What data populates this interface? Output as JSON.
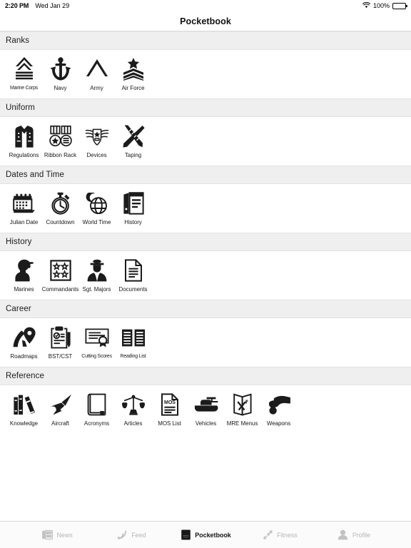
{
  "status_bar": {
    "time": "2:20 PM",
    "date": "Wed Jan 29",
    "battery_percent": "100%",
    "wifi_icon": "wifi-icon",
    "battery_icon": "battery-full-icon"
  },
  "nav": {
    "title": "Pocketbook"
  },
  "sections": [
    {
      "title": "Ranks",
      "items": [
        {
          "label": "Marine Corps",
          "icon": "chevron-rank-insignia-icon"
        },
        {
          "label": "Navy",
          "icon": "anchor-icon"
        },
        {
          "label": "Army",
          "icon": "chevron-stripe-icon"
        },
        {
          "label": "Air Force",
          "icon": "star-chevrons-icon"
        }
      ]
    },
    {
      "title": "Uniform",
      "items": [
        {
          "label": "Regulations",
          "icon": "uniform-jacket-icon"
        },
        {
          "label": "Ribbon Rack",
          "icon": "medals-icon"
        },
        {
          "label": "Devices",
          "icon": "winged-badge-icon"
        },
        {
          "label": "Taping",
          "icon": "ruler-pencil-cross-icon"
        }
      ]
    },
    {
      "title": "Dates and Time",
      "items": [
        {
          "label": "Julian Date",
          "icon": "calendar-icon"
        },
        {
          "label": "Countdown",
          "icon": "stopwatch-icon"
        },
        {
          "label": "World Time",
          "icon": "globe-moon-icon"
        },
        {
          "label": "History",
          "icon": "books-shelf-icon"
        }
      ]
    },
    {
      "title": "History",
      "items": [
        {
          "label": "Marines",
          "icon": "soldier-silhouette-icon"
        },
        {
          "label": "Commandants",
          "icon": "four-stars-icon"
        },
        {
          "label": "Sgt. Majors",
          "icon": "officer-portrait-icon"
        },
        {
          "label": "Documents",
          "icon": "document-icon"
        }
      ]
    },
    {
      "title": "Career",
      "items": [
        {
          "label": "Roadmaps",
          "icon": "road-pin-icon"
        },
        {
          "label": "BST/CST",
          "icon": "clipboard-pencil-icon"
        },
        {
          "label": "Cutting Scores",
          "icon": "certificate-icon"
        },
        {
          "label": "Reading List",
          "icon": "open-book-icon"
        }
      ]
    },
    {
      "title": "Reference",
      "items": [
        {
          "label": "Knowledge",
          "icon": "books-stack-icon"
        },
        {
          "label": "Aircraft",
          "icon": "jet-icon"
        },
        {
          "label": "Acronyms",
          "icon": "closed-book-icon"
        },
        {
          "label": "Articles",
          "icon": "scales-icon"
        },
        {
          "label": "MOS List",
          "icon": "mos-document-icon"
        },
        {
          "label": "Vehicles",
          "icon": "tank-icon"
        },
        {
          "label": "MRE Menus",
          "icon": "menu-card-icon"
        },
        {
          "label": "Weapons",
          "icon": "cannon-icon"
        }
      ]
    }
  ],
  "tabbar": {
    "tabs": [
      {
        "label": "News",
        "icon": "newspaper-icon",
        "active": false
      },
      {
        "label": "Feed",
        "icon": "rss-icon",
        "active": false
      },
      {
        "label": "Pocketbook",
        "icon": "book-icon",
        "active": true
      },
      {
        "label": "Fitness",
        "icon": "running-icon",
        "active": false
      },
      {
        "label": "Profile",
        "icon": "person-icon",
        "active": false
      }
    ]
  }
}
